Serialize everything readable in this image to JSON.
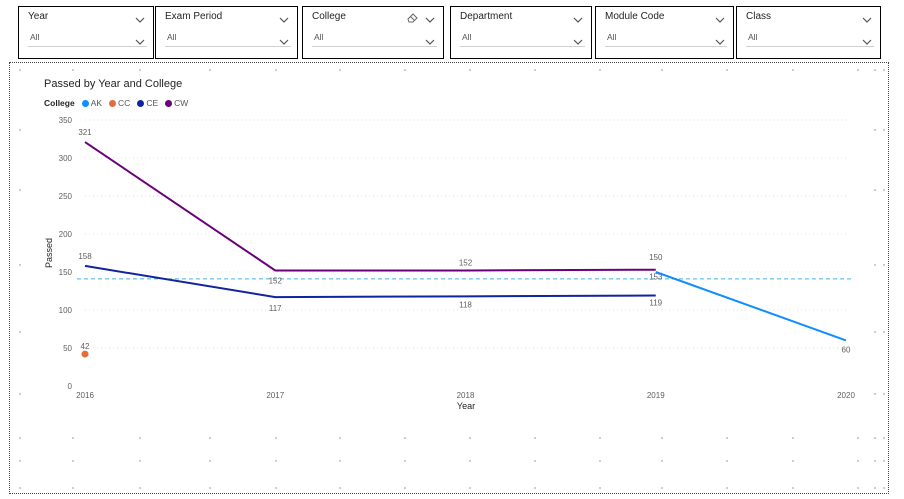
{
  "slicers": [
    {
      "title": "Year",
      "value": "All",
      "has_eraser": false
    },
    {
      "title": "Exam Period",
      "value": "All",
      "has_eraser": false
    },
    {
      "title": "College",
      "value": "All",
      "has_eraser": true
    },
    {
      "title": "Department",
      "value": "All",
      "has_eraser": false
    },
    {
      "title": "Module Code",
      "value": "All",
      "has_eraser": false
    },
    {
      "title": "Class",
      "value": "All",
      "has_eraser": false
    }
  ],
  "colors": {
    "AK": "#118DFF",
    "CC": "#E66C37",
    "CE": "#12239E",
    "CW": "#6B007B",
    "average_line": "#46B4E7"
  },
  "chart_data": {
    "type": "line",
    "title": "Passed by Year and College",
    "xlabel": "Year",
    "ylabel": "Passed",
    "legend_title": "College",
    "legend_position": "top-left",
    "x": [
      2016,
      2017,
      2018,
      2019,
      2020
    ],
    "x_ticks": [
      "2016",
      "2017",
      "2018",
      "2019",
      "2020"
    ],
    "y_ticks": [
      "0",
      "50",
      "100",
      "150",
      "200",
      "250",
      "300",
      "350"
    ],
    "ylim": [
      0,
      350
    ],
    "grid": true,
    "series": [
      {
        "name": "AK",
        "points": [
          [
            2019,
            150
          ],
          [
            2020,
            60
          ]
        ],
        "labels": [
          "150",
          "60"
        ]
      },
      {
        "name": "CC",
        "points": [
          [
            2016,
            42
          ]
        ],
        "labels": [
          "42"
        ]
      },
      {
        "name": "CE",
        "points": [
          [
            2016,
            158
          ],
          [
            2017,
            117
          ],
          [
            2018,
            118
          ],
          [
            2019,
            119
          ]
        ],
        "labels": [
          "158",
          "117",
          "118",
          "119"
        ]
      },
      {
        "name": "CW",
        "points": [
          [
            2016,
            321
          ],
          [
            2017,
            152
          ],
          [
            2018,
            152
          ],
          [
            2019,
            153
          ]
        ],
        "labels": [
          "321",
          "152",
          "152",
          "153"
        ]
      }
    ],
    "average_line": 141
  }
}
